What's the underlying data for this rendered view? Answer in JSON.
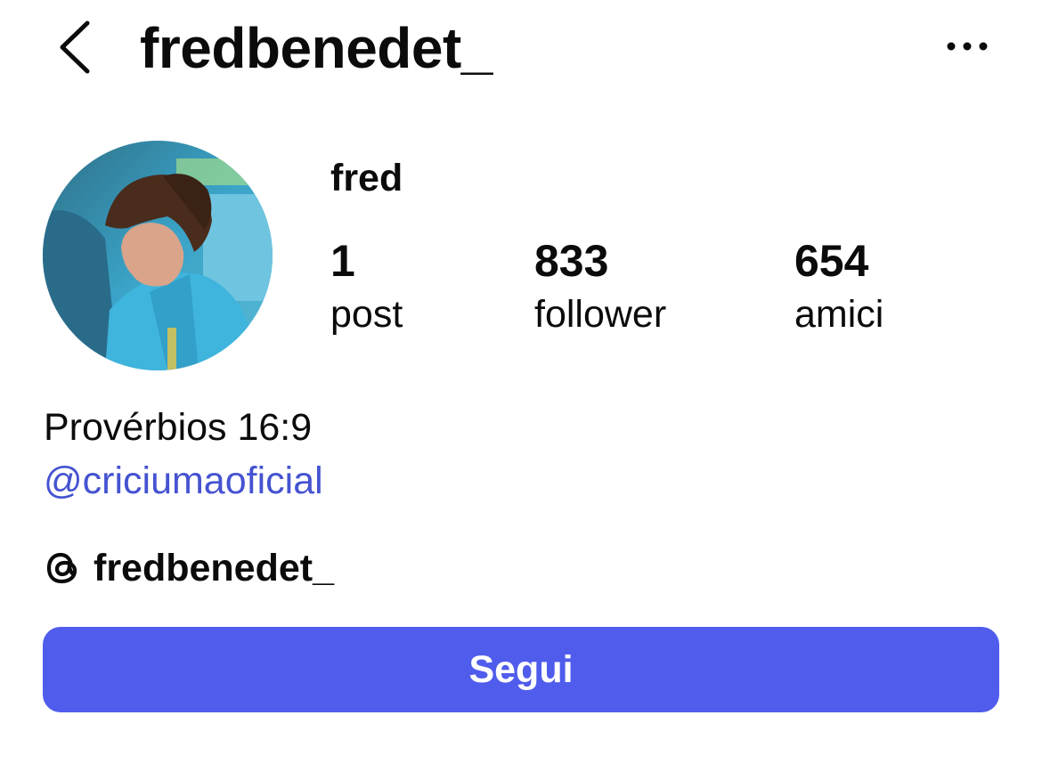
{
  "colors": {
    "text": "#0b0b0b",
    "accent": "#4f5cec",
    "link": "#4553d1",
    "button_text": "#ffffff"
  },
  "header": {
    "back_icon": "chevron-left-icon",
    "username": "fredbenedet_",
    "more_icon": "ellipsis-icon"
  },
  "profile": {
    "display_name": "fred",
    "stats": [
      {
        "value": "1",
        "label": "post"
      },
      {
        "value": "833",
        "label": "follower"
      },
      {
        "value": "654",
        "label": "amici"
      }
    ],
    "bio": {
      "text": "Provérbios 16:9",
      "mention": "@criciumaoficial"
    },
    "threads": {
      "icon": "threads-icon",
      "handle": "fredbenedet_"
    }
  },
  "actions": {
    "follow_label": "Segui"
  }
}
